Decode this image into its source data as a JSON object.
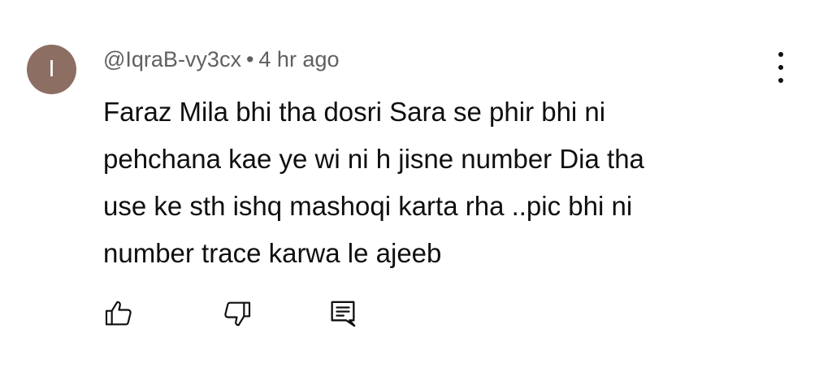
{
  "comment": {
    "avatar_letter": "I",
    "avatar_color": "#8d6e63",
    "author": "@IqraB-vy3cx",
    "separator": "•",
    "timestamp": "4 hr ago",
    "text_lines": [
      "Faraz Mila bhi tha dosri Sara se phir bhi ni",
      "pehchana kae ye wi ni h jisne number Dia tha",
      "use ke sth ishq mashoqi karta rha ..pic bhi ni",
      "number trace karwa le ajeeb"
    ]
  },
  "actions": {
    "like_icon": "thumb-up-icon",
    "dislike_icon": "thumb-down-icon",
    "reply_icon": "reply-comment-icon",
    "menu_icon": "more-vert-icon"
  }
}
